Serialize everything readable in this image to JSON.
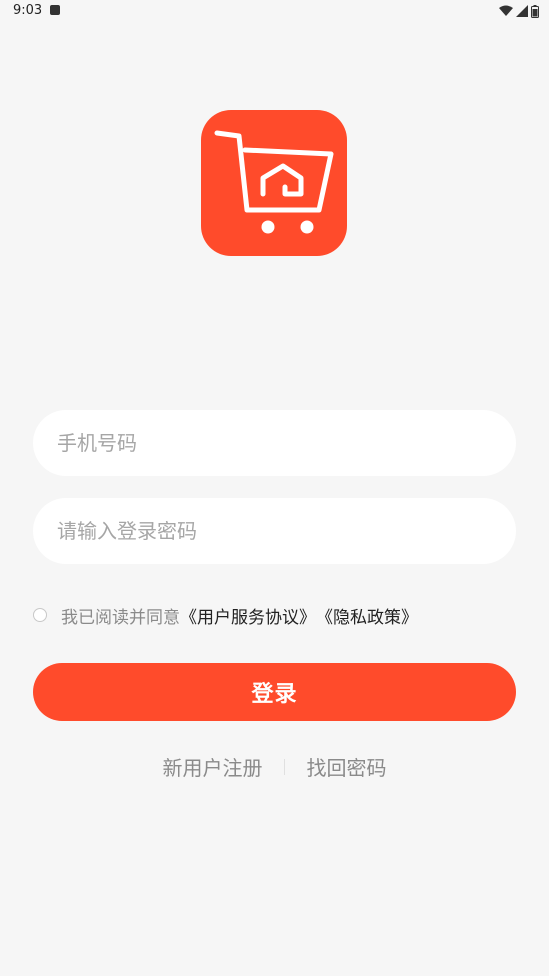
{
  "status_bar": {
    "time": "9:03",
    "icons": [
      "notification-icon",
      "wifi-icon",
      "signal-icon",
      "battery-icon"
    ]
  },
  "logo": {
    "icon": "shopping-cart-house-icon",
    "bg_color": "#ff4b2b"
  },
  "form": {
    "phone_placeholder": "手机号码",
    "phone_value": "",
    "password_placeholder": "请输入登录密码",
    "password_value": ""
  },
  "agreement": {
    "checked": false,
    "prefix": "我已阅读并同意",
    "user_agreement": "《用户服务协议》",
    "privacy_policy": "《隐私政策》"
  },
  "login_button": {
    "label": "登录",
    "color": "#ff4b2b"
  },
  "links": {
    "register": "新用户注册",
    "forgot_password": "找回密码"
  }
}
